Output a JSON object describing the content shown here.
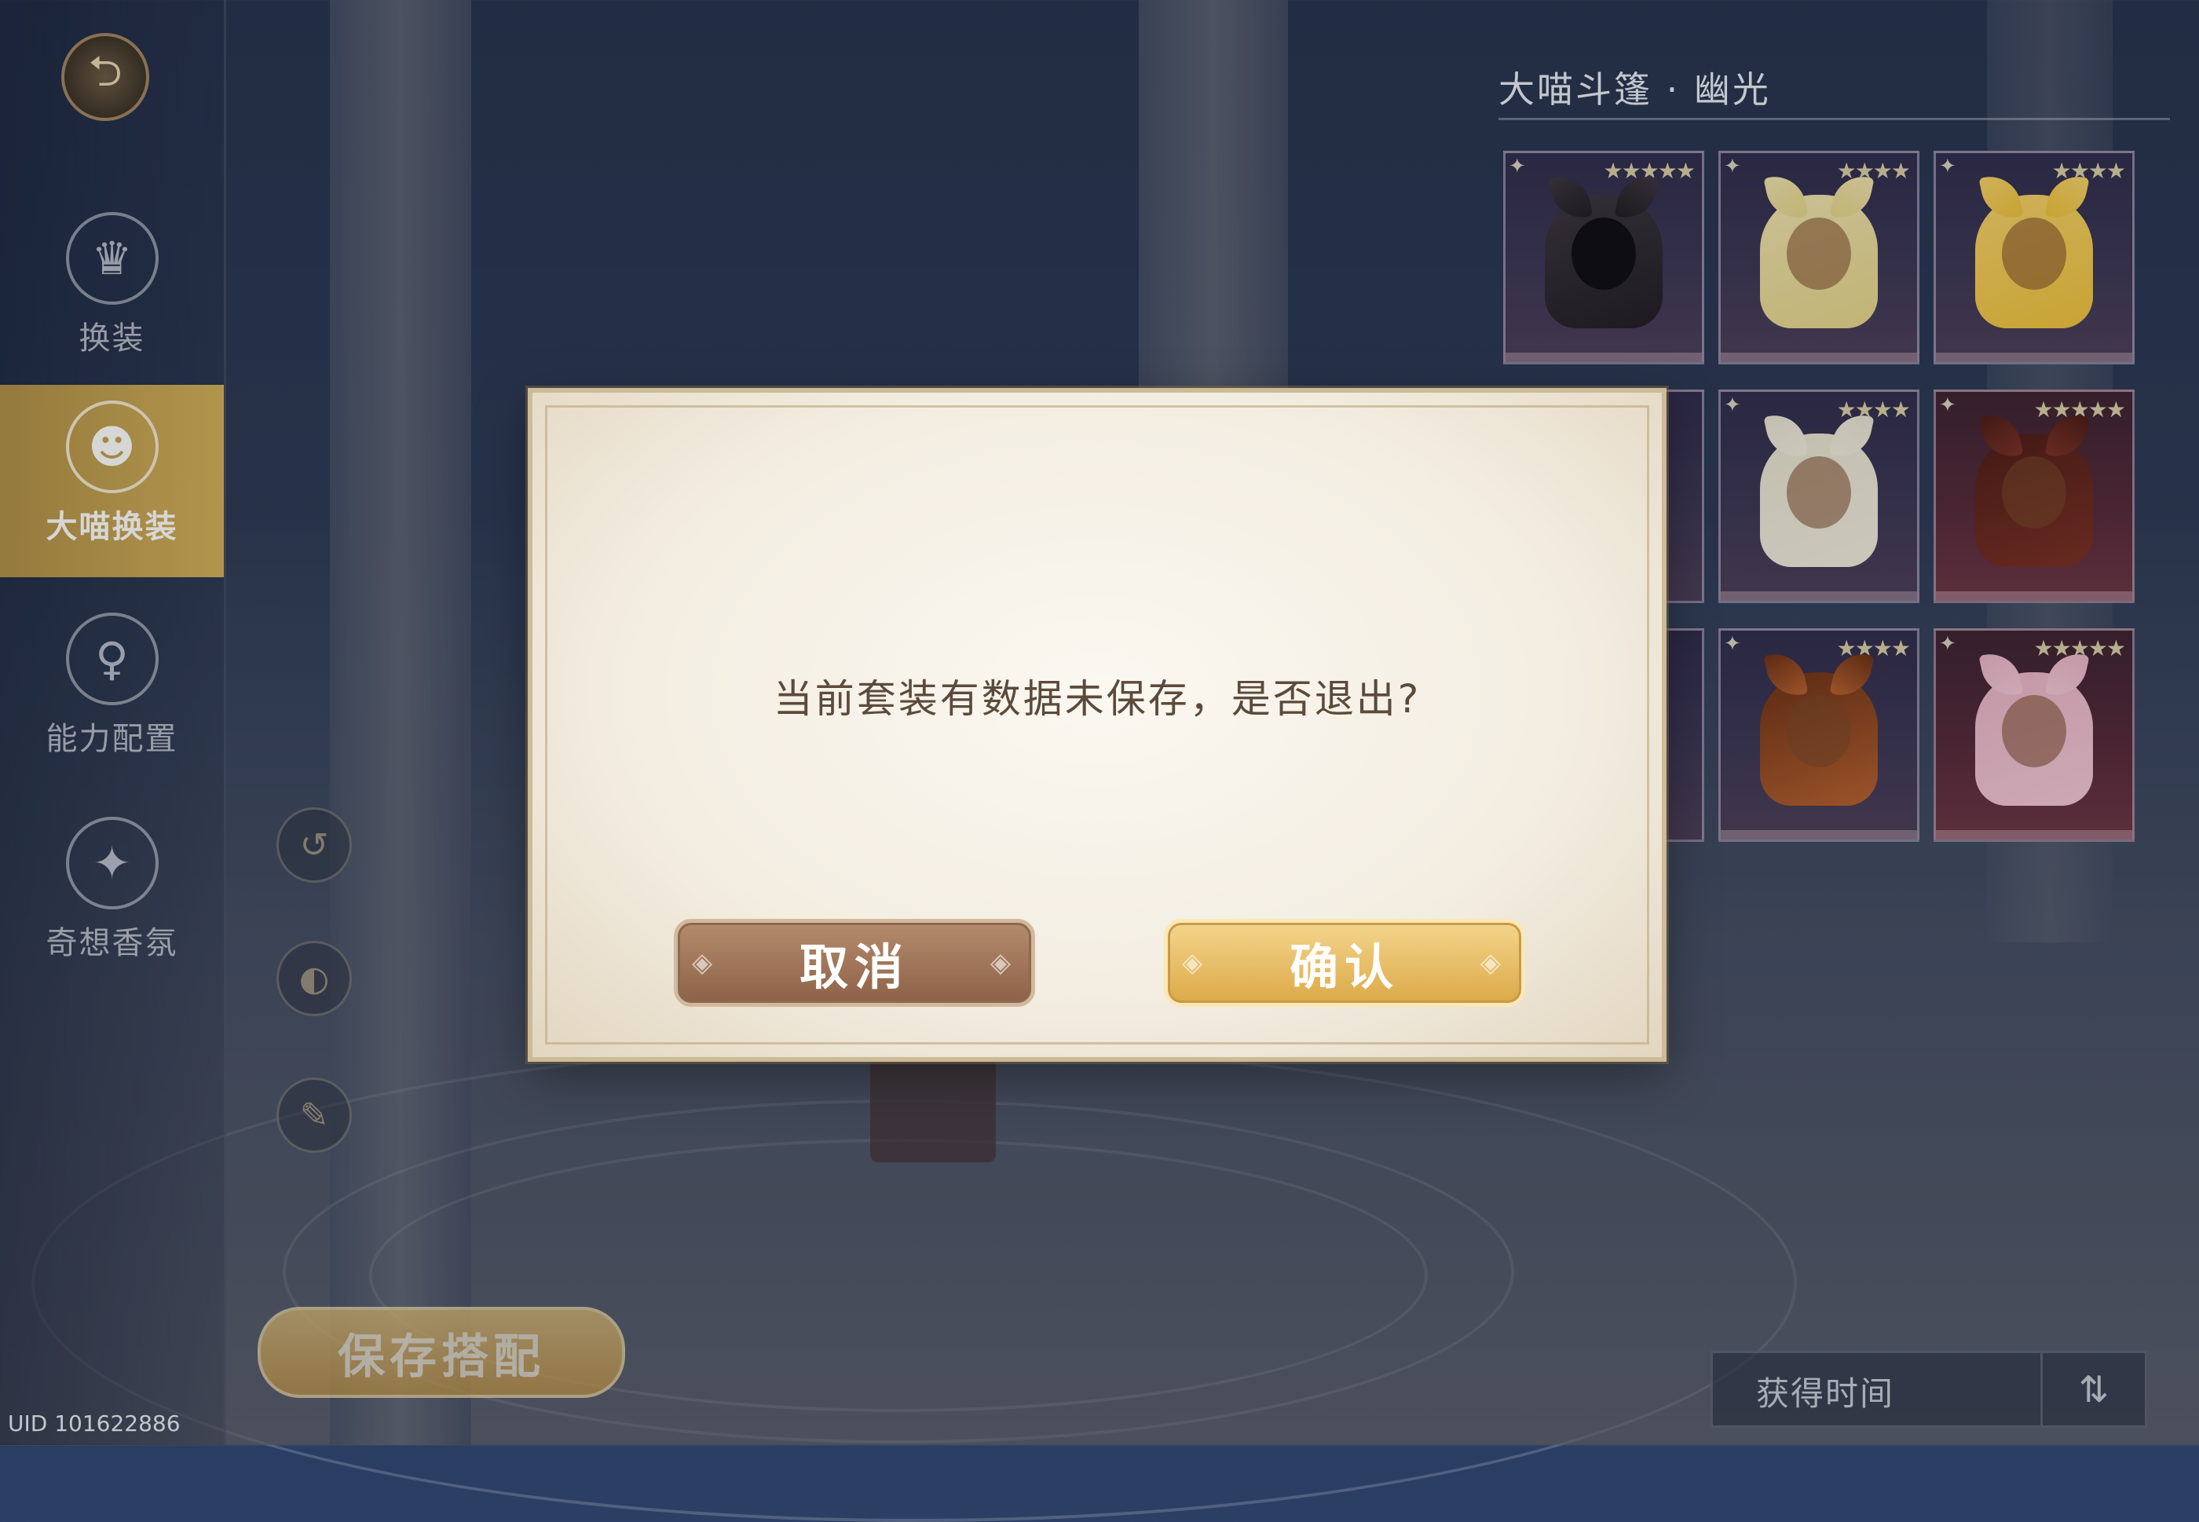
{
  "sidebar": {
    "back_icon": "back-arrow-icon",
    "items": [
      {
        "label": "换装",
        "icon": "dress-icon",
        "active": false
      },
      {
        "label": "大喵换装",
        "icon": "cat-icon",
        "active": true
      },
      {
        "label": "能力配置",
        "icon": "girl-icon",
        "active": false
      },
      {
        "label": "奇想香氛",
        "icon": "perfume-icon",
        "active": false
      }
    ]
  },
  "panel": {
    "title": "大喵斗篷 · 幽光",
    "cards": [
      {
        "stars": "★★★★★",
        "theme": "dark",
        "colors": [
          "#1d1a22",
          "#3a3440"
        ]
      },
      {
        "stars": "★★★★",
        "theme": "purple",
        "colors": [
          "#e6d68a",
          "#f0e4b0"
        ]
      },
      {
        "stars": "★★★★",
        "theme": "purple",
        "colors": [
          "#f0c23a",
          "#f5d26a"
        ]
      },
      {
        "stars": "★★★★",
        "theme": "purple",
        "colors": [
          "#f2eee0",
          "#e8e3d2"
        ]
      },
      {
        "stars": "★★★★★",
        "theme": "red",
        "colors": [
          "#7a2e24",
          "#4a1a14"
        ]
      },
      {
        "stars": "★★★★",
        "theme": "purple",
        "colors": [
          "#b8602e",
          "#6a2e14"
        ]
      },
      {
        "stars": "★★★★★",
        "theme": "red",
        "colors": [
          "#f4c8d8",
          "#eab4c8"
        ]
      }
    ],
    "sort_label": "获得时间",
    "sort_icon": "sort-toggle-icon"
  },
  "save_label": "保存搭配",
  "uid": "UID 101622886",
  "dialog": {
    "message": "当前套装有数据未保存，是否退出?",
    "cancel": "取消",
    "confirm": "确认"
  }
}
